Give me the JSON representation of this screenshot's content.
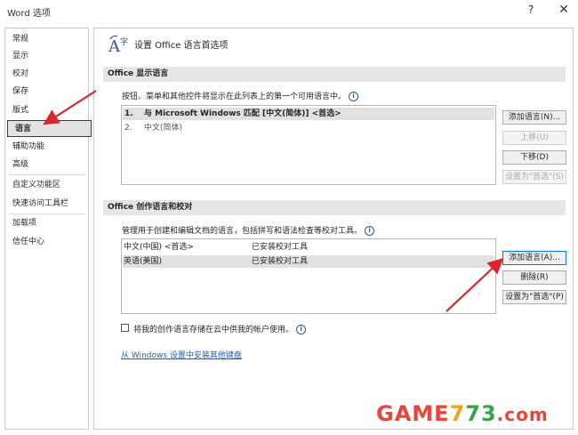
{
  "window": {
    "title": "Word 选项",
    "help": "?",
    "close": "✕"
  },
  "sidebar": {
    "items": [
      {
        "label": "常规"
      },
      {
        "label": "显示"
      },
      {
        "label": "校对"
      },
      {
        "label": "保存"
      },
      {
        "label": "版式"
      },
      {
        "label": "语言"
      },
      {
        "label": "辅助功能"
      },
      {
        "label": "高级"
      },
      {
        "label": "自定义功能区"
      },
      {
        "label": "快速访问工具栏"
      },
      {
        "label": "加载项"
      },
      {
        "label": "信任中心"
      }
    ],
    "selected": "语言"
  },
  "header": {
    "title": "设置 Office 语言首选项"
  },
  "display_section": {
    "title": "Office 显示语言",
    "description": "按钮、菜单和其他控件将显示在此列表上的第一个可用语言中。",
    "languages": [
      {
        "num": "1.",
        "text": "与 Microsoft Windows 匹配 [中文(简体)] <首选>"
      },
      {
        "num": "2.",
        "text": "中文(简体)"
      }
    ],
    "buttons": {
      "add": "添加语言(N)...",
      "up": "上移(U)",
      "down": "下移(D)",
      "set_preferred": "设置为\"首选\"(S)"
    }
  },
  "authoring_section": {
    "title": "Office 创作语言和校对",
    "description": "管理用于创建和编辑文档的语言，包括拼写和语法检查等校对工具。",
    "languages": [
      {
        "name": "中文(中国) <首选>",
        "status": "已安装校对工具"
      },
      {
        "name": "英语(美国)",
        "status": "已安装校对工具"
      }
    ],
    "buttons": {
      "add": "添加语言(A)...",
      "remove": "删除(R)",
      "set_preferred": "设置为\"首选\"(P)"
    },
    "checkbox_label": "将我的创作语言存储在云中供我的帐户使用。",
    "link": "从 Windows 设置中安装其他键盘"
  },
  "watermark": {
    "part1": "GAME",
    "part2": "7",
    "part3": "73",
    "part4": ".com"
  },
  "colors": {
    "arrow": "#d9262b",
    "accent": "#2b579a",
    "link": "#1f5fb4"
  }
}
